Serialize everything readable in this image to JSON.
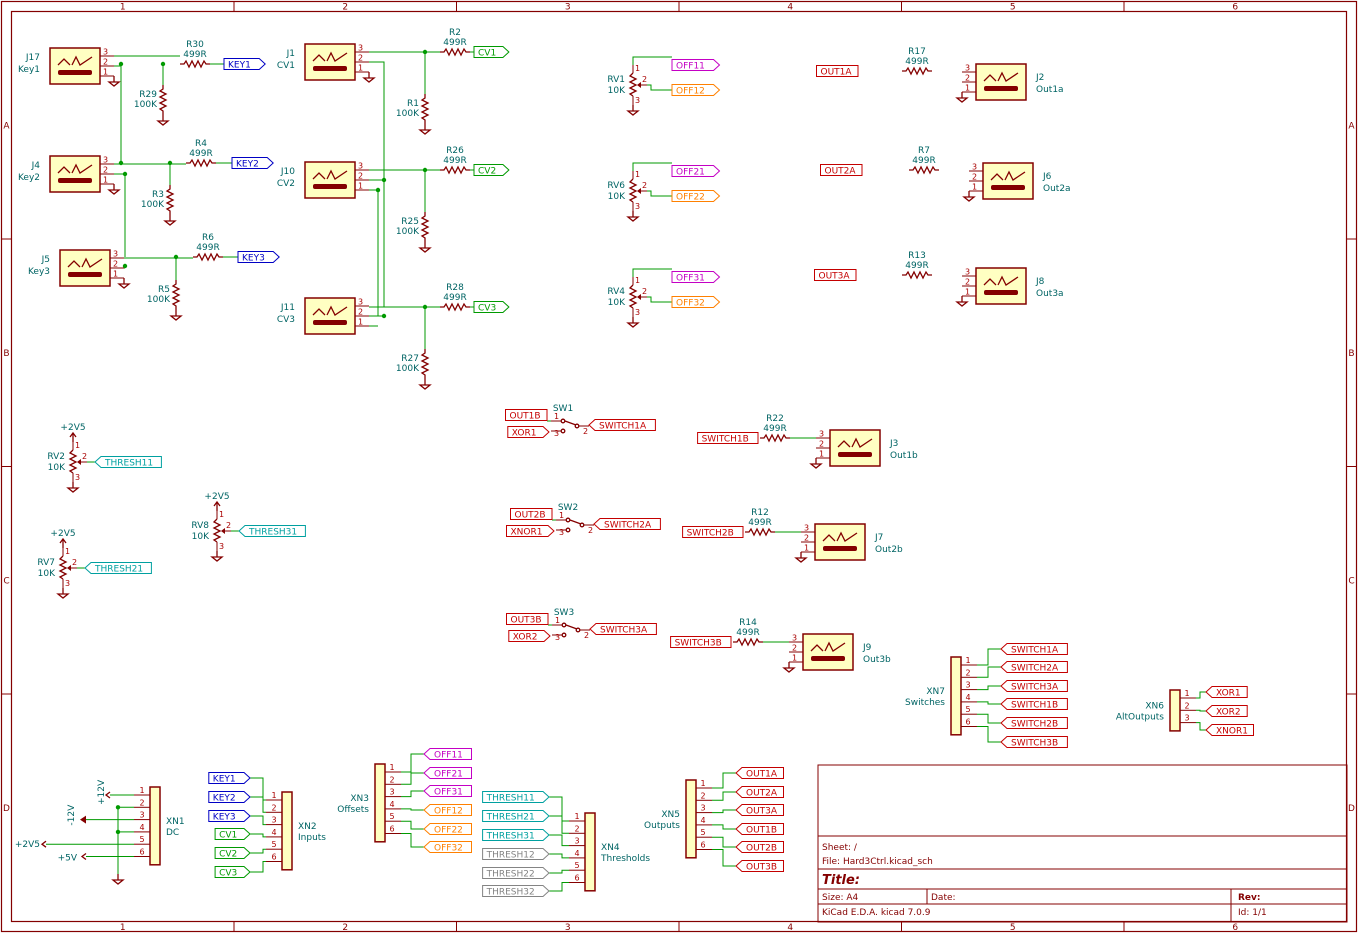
{
  "grid": {
    "columns": [
      "1",
      "2",
      "3",
      "4",
      "5",
      "6"
    ],
    "rows": [
      "A",
      "B",
      "C",
      "D"
    ]
  },
  "title_block": {
    "sheet": "Sheet: /",
    "file": "File: Hard3Ctrl.kicad_sch",
    "title": "Title:",
    "size": "Size: A4",
    "date": "Date:",
    "rev": "Rev:",
    "tool": "KiCad E.D.A.  kicad 7.0.9",
    "id": "Id: 1/1"
  },
  "colors": {
    "wire": "#009a00",
    "symbol": "#840000",
    "body_fill": "#ffffc2",
    "ref_text": "#006464",
    "label_blue": "#0000c4",
    "label_green": "#009a00",
    "label_red": "#c40000",
    "label_magenta": "#c400c4",
    "label_orange": "#ff8000",
    "label_cyan": "#00a0a0",
    "label_gray": "#848484"
  },
  "jacks": [
    {
      "ref": "J17",
      "val": "Key1"
    },
    {
      "ref": "J4",
      "val": "Key2"
    },
    {
      "ref": "J5",
      "val": "Key3"
    },
    {
      "ref": "J1",
      "val": "CV1"
    },
    {
      "ref": "J10",
      "val": "CV2"
    },
    {
      "ref": "J11",
      "val": "CV3"
    },
    {
      "ref": "J2",
      "val": "Out1a"
    },
    {
      "ref": "J6",
      "val": "Out2a"
    },
    {
      "ref": "J8",
      "val": "Out3a"
    },
    {
      "ref": "J3",
      "val": "Out1b"
    },
    {
      "ref": "J7",
      "val": "Out2b"
    },
    {
      "ref": "J9",
      "val": "Out3b"
    }
  ],
  "resistors": [
    {
      "ref": "R30",
      "val": "499R"
    },
    {
      "ref": "R29",
      "val": "100K"
    },
    {
      "ref": "R4",
      "val": "499R"
    },
    {
      "ref": "R3",
      "val": "100K"
    },
    {
      "ref": "R6",
      "val": "499R"
    },
    {
      "ref": "R5",
      "val": "100K"
    },
    {
      "ref": "R2",
      "val": "499R"
    },
    {
      "ref": "R1",
      "val": "100K"
    },
    {
      "ref": "R26",
      "val": "499R"
    },
    {
      "ref": "R25",
      "val": "100K"
    },
    {
      "ref": "R28",
      "val": "499R"
    },
    {
      "ref": "R27",
      "val": "100K"
    },
    {
      "ref": "R17",
      "val": "499R"
    },
    {
      "ref": "R7",
      "val": "499R"
    },
    {
      "ref": "R13",
      "val": "499R"
    },
    {
      "ref": "R22",
      "val": "499R"
    },
    {
      "ref": "R12",
      "val": "499R"
    },
    {
      "ref": "R14",
      "val": "499R"
    }
  ],
  "pots": [
    {
      "ref": "RV1",
      "val": "10K"
    },
    {
      "ref": "RV6",
      "val": "10K"
    },
    {
      "ref": "RV4",
      "val": "10K"
    },
    {
      "ref": "RV2",
      "val": "10K"
    },
    {
      "ref": "RV7",
      "val": "10K"
    },
    {
      "ref": "RV8",
      "val": "10K"
    }
  ],
  "switches": [
    "SW1",
    "SW2",
    "SW3"
  ],
  "power": [
    "+2V5",
    "+2V5",
    "+2V5",
    "+12V",
    "-12V",
    "+2V5",
    "+5V"
  ],
  "labels": {
    "KEY1": "KEY1",
    "KEY2": "KEY2",
    "KEY3": "KEY3",
    "CV1": "CV1",
    "CV2": "CV2",
    "CV3": "CV3",
    "OFF11": "OFF11",
    "OFF12": "OFF12",
    "OFF21": "OFF21",
    "OFF22": "OFF22",
    "OFF31": "OFF31",
    "OFF32": "OFF32",
    "OUT1A": "OUT1A",
    "OUT2A": "OUT2A",
    "OUT3A": "OUT3A",
    "OUT1B": "OUT1B",
    "OUT2B": "OUT2B",
    "OUT3B": "OUT3B",
    "XOR1": "XOR1",
    "XOR2": "XOR2",
    "XNOR1": "XNOR1",
    "SWITCH1A": "SWITCH1A",
    "SWITCH2A": "SWITCH2A",
    "SWITCH3A": "SWITCH3A",
    "SWITCH1B": "SWITCH1B",
    "SWITCH2B": "SWITCH2B",
    "SWITCH3B": "SWITCH3B",
    "THRESH11": "THRESH11",
    "THRESH21": "THRESH21",
    "THRESH31": "THRESH31",
    "THRESH12": "THRESH12",
    "THRESH22": "THRESH22",
    "THRESH32": "THRESH32"
  },
  "headers": [
    {
      "ref": "XN1",
      "val": "DC"
    },
    {
      "ref": "XN2",
      "val": "Inputs"
    },
    {
      "ref": "XN3",
      "val": "Offsets"
    },
    {
      "ref": "XN4",
      "val": "Thresholds"
    },
    {
      "ref": "XN5",
      "val": "Outputs"
    },
    {
      "ref": "XN6",
      "val": "AltOutputs"
    },
    {
      "ref": "XN7",
      "val": "Switches"
    }
  ]
}
